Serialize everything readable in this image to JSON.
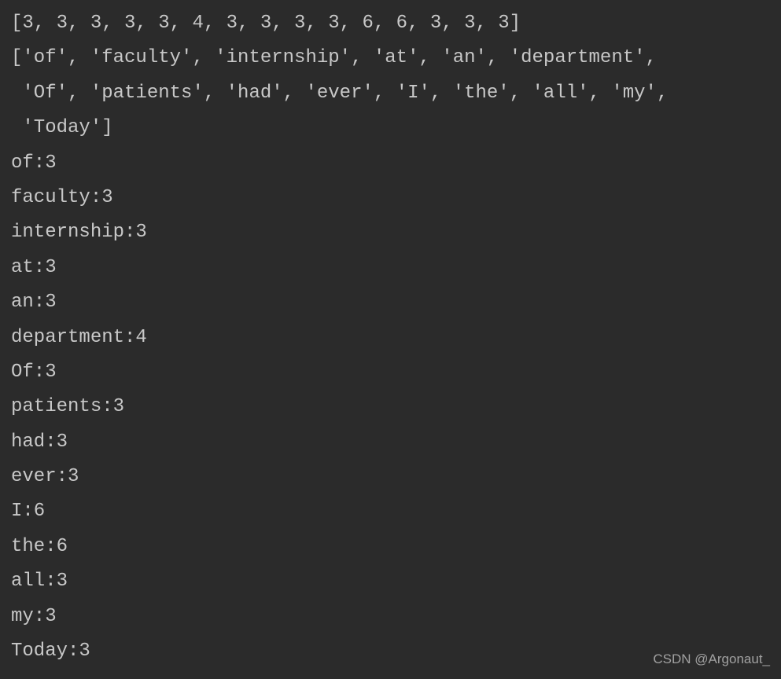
{
  "output": {
    "numbers_list": "[3, 3, 3, 3, 3, 4, 3, 3, 3, 3, 6, 6, 3, 3, 3]",
    "words_list": "['of', 'faculty', 'internship', 'at', 'an', 'department',\n 'Of', 'patients', 'had', 'ever', 'I', 'the', 'all', 'my',\n 'Today']",
    "word_counts": [
      {
        "word": "of",
        "count": 3
      },
      {
        "word": "faculty",
        "count": 3
      },
      {
        "word": "internship",
        "count": 3
      },
      {
        "word": "at",
        "count": 3
      },
      {
        "word": "an",
        "count": 3
      },
      {
        "word": "department",
        "count": 4
      },
      {
        "word": "Of",
        "count": 3
      },
      {
        "word": "patients",
        "count": 3
      },
      {
        "word": "had",
        "count": 3
      },
      {
        "word": "ever",
        "count": 3
      },
      {
        "word": "I",
        "count": 6
      },
      {
        "word": "the",
        "count": 6
      },
      {
        "word": "all",
        "count": 3
      },
      {
        "word": "my",
        "count": 3
      },
      {
        "word": "Today",
        "count": 3
      }
    ]
  },
  "watermark": "CSDN @Argonaut_"
}
